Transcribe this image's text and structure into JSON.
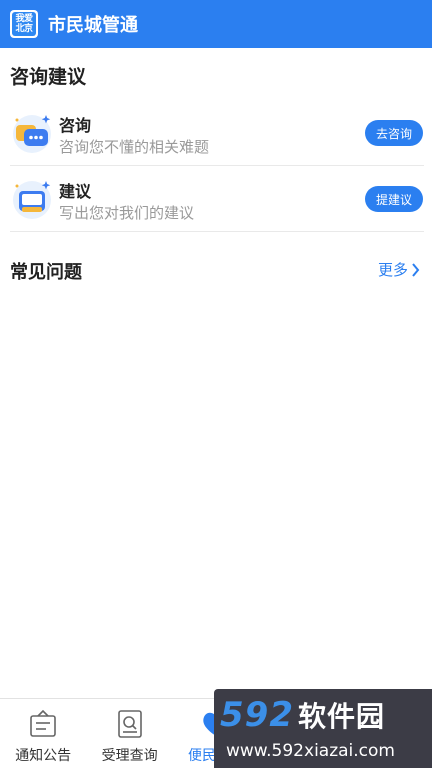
{
  "header": {
    "logo_line1": "我爱",
    "logo_line2": "北京",
    "title": "市民城管通"
  },
  "consult_section": {
    "title": "咨询建议",
    "items": [
      {
        "title": "咨询",
        "desc": "咨询您不懂的相关难题",
        "button": "去咨询",
        "icon": "chat-bubble-icon"
      },
      {
        "title": "建议",
        "desc": "写出您对我们的建议",
        "button": "提建议",
        "icon": "suggestion-box-icon"
      }
    ]
  },
  "faq_section": {
    "title": "常见问题",
    "more": "更多"
  },
  "bottom_nav": {
    "items": [
      {
        "label": "通知公告",
        "icon": "notice-board-icon"
      },
      {
        "label": "受理查询",
        "icon": "search-document-icon"
      },
      {
        "label": "便民服务",
        "icon": "heart-service-icon",
        "active": true
      },
      {
        "label": "",
        "icon": ""
      },
      {
        "label": "",
        "icon": ""
      }
    ]
  },
  "watermark": {
    "brand_number": "592",
    "brand_cn": "软件园",
    "url": "www.592xiazai.com"
  },
  "colors": {
    "primary": "#2b7ff0",
    "text": "#222222",
    "muted": "#9a9a9a"
  }
}
